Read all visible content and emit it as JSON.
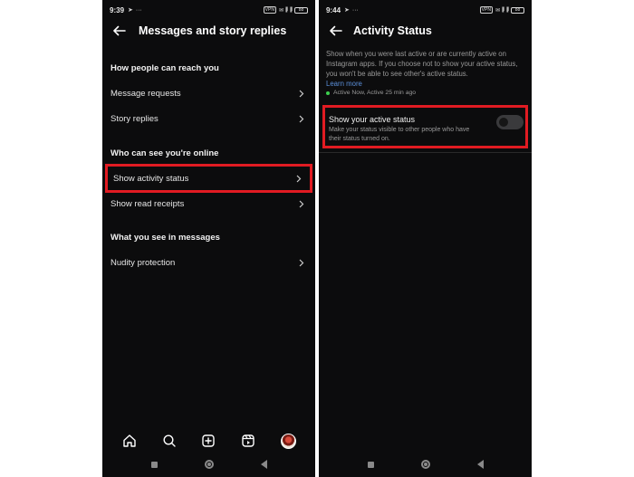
{
  "left": {
    "status_time": "9:39",
    "status_percent": "88",
    "header_title": "Messages and story replies",
    "section_reach": "How people can reach you",
    "row_message_requests": "Message requests",
    "row_story_replies": "Story replies",
    "section_online": "Who can see you're online",
    "row_activity_status": "Show activity status",
    "row_read_receipts": "Show read receipts",
    "section_messages": "What you see in messages",
    "row_nudity": "Nudity protection",
    "nav_icons": [
      "home-icon",
      "search-icon",
      "create-icon",
      "reels-icon",
      "profile-avatar"
    ]
  },
  "right": {
    "status_time": "9:44",
    "status_percent": "88",
    "header_title": "Activity Status",
    "description": "Show when you were last active or are currently active on Instagram apps. If you choose not to show your active status, you won't be able to see other's active status.",
    "learn_more": "Learn more",
    "active_line": "Active Now, Active 25 min ago",
    "toggle_title": "Show your active status",
    "toggle_desc": "Make your status visible to other people who have their status turned on.",
    "toggle_on": false
  },
  "colors": {
    "background": "#0c0c0d",
    "highlight": "#e11b22",
    "link": "#5b8fd9",
    "active_dot": "#3ccf4e"
  }
}
